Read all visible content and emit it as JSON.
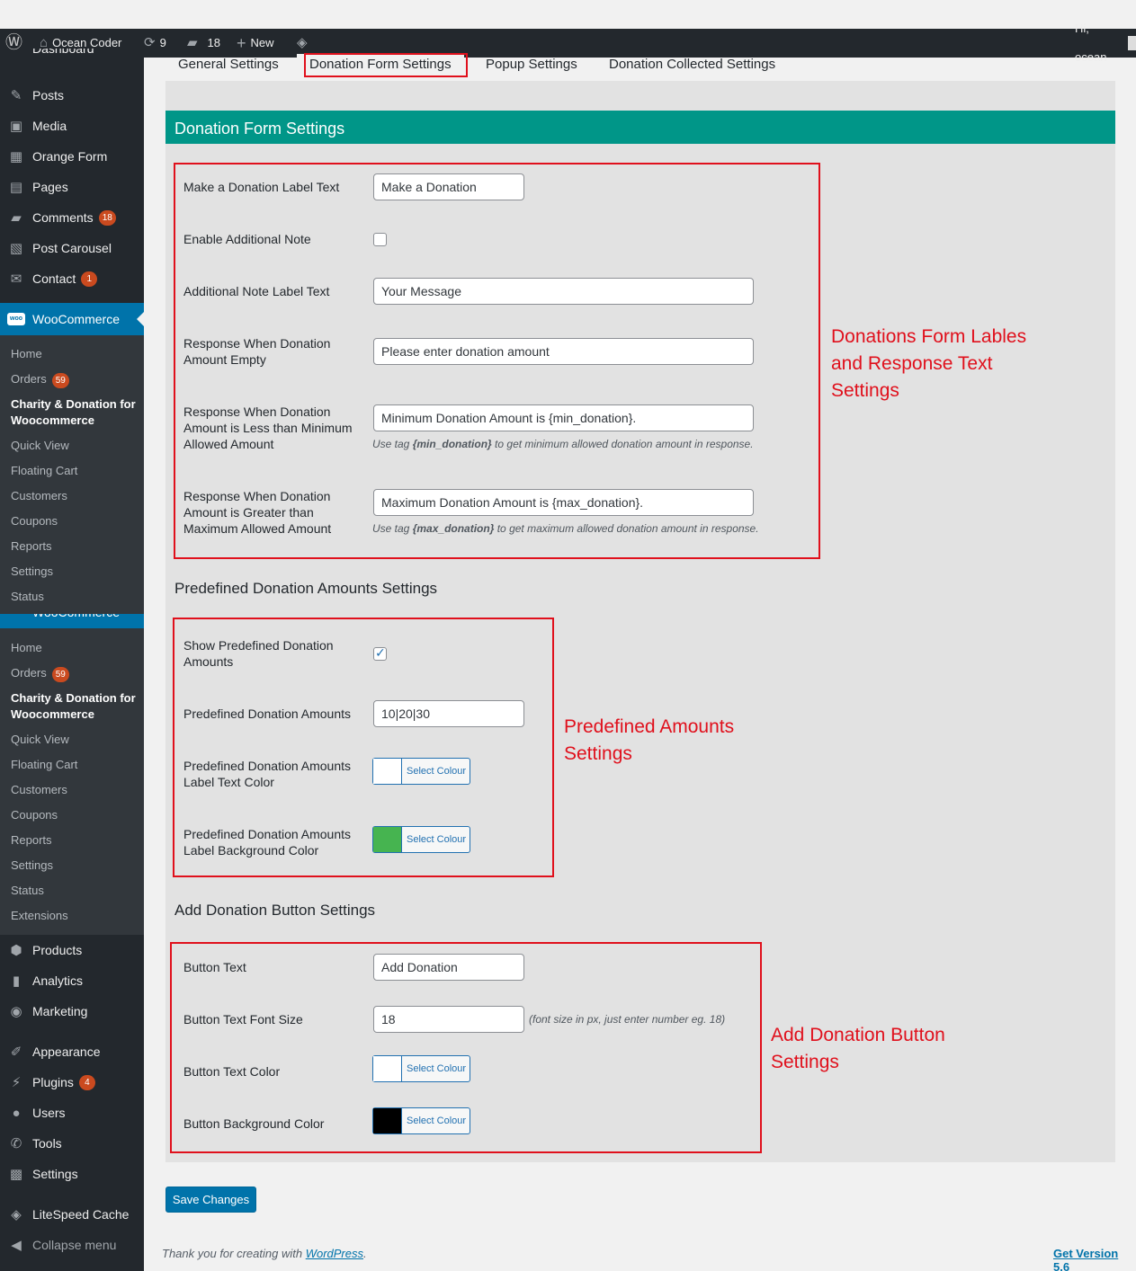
{
  "admin_bar": {
    "site_name": "Ocean Coder",
    "updates_count": "9",
    "comments_count": "18",
    "new_label": "New",
    "greeting": "Hi, ocean"
  },
  "sidebar": {
    "cutoff_top": "Dashboard",
    "items": [
      {
        "label": "Posts",
        "icon": "pin-icon"
      },
      {
        "label": "Media",
        "icon": "media-icon"
      },
      {
        "label": "Orange Form",
        "icon": "form-icon"
      },
      {
        "label": "Pages",
        "icon": "pages-icon"
      },
      {
        "label": "Comments",
        "icon": "comment-icon",
        "badge": "18"
      },
      {
        "label": "Post Carousel",
        "icon": "carousel-icon"
      },
      {
        "label": "Contact",
        "icon": "mail-icon",
        "badge": "1"
      }
    ],
    "woo": {
      "label": "WooCommerce",
      "logo": "woo",
      "submenu1": [
        "Home",
        "Orders",
        "Charity & Donation for Woocommerce",
        "Quick View",
        "Floating Cart",
        "Customers",
        "Coupons",
        "Reports",
        "Settings",
        "Status"
      ],
      "orders_badge": "59",
      "submenu2": [
        "Home",
        "Orders",
        "Charity & Donation for Woocommerce",
        "Quick View",
        "Floating Cart",
        "Customers",
        "Coupons",
        "Reports",
        "Settings",
        "Status",
        "Extensions"
      ]
    },
    "items2": [
      {
        "label": "Products",
        "icon": "box-icon"
      },
      {
        "label": "Analytics",
        "icon": "chart-icon"
      },
      {
        "label": "Marketing",
        "icon": "megaphone-icon"
      },
      {
        "label": "Appearance",
        "icon": "brush-icon"
      },
      {
        "label": "Plugins",
        "icon": "plug-icon",
        "badge": "4"
      },
      {
        "label": "Users",
        "icon": "user-icon"
      },
      {
        "label": "Tools",
        "icon": "wrench-icon"
      },
      {
        "label": "Settings",
        "icon": "sliders-icon"
      },
      {
        "label": "LiteSpeed Cache",
        "icon": "diamond-icon"
      },
      {
        "label": "Collapse menu",
        "icon": "collapse-icon"
      }
    ]
  },
  "tabs": [
    "General Settings",
    "Donation Form Settings",
    "Popup Settings",
    "Donation Collected Settings"
  ],
  "panel_title": "Donation Form Settings",
  "form": {
    "make_label": "Make a Donation Label Text",
    "make_value": "Make a Donation",
    "enable_note_label": "Enable Additional Note",
    "note_label_label": "Additional Note Label Text",
    "note_label_value": "Your Message",
    "empty_label": "Response When Donation Amount Empty",
    "empty_value": "Please enter donation amount",
    "less_label": "Response When Donation Amount is Less than Minimum Allowed Amount",
    "less_value": "Minimum Donation Amount is {min_donation}.",
    "less_desc_pre": "Use tag ",
    "less_desc_tag": "{min_donation}",
    "less_desc_post": " to get minimum allowed donation amount in response.",
    "greater_label": "Response When Donation Amount is Greater than Maximum Allowed Amount",
    "greater_value": "Maximum Donation Amount is {max_donation}.",
    "greater_desc_pre": "Use tag ",
    "greater_desc_tag": "{max_donation}",
    "greater_desc_post": " to get maximum allowed donation amount in response."
  },
  "predefined": {
    "title": "Predefined Donation Amounts Settings",
    "show_label": "Show Predefined Donation Amounts",
    "amounts_label": "Predefined Donation Amounts",
    "amounts_value": "10|20|30",
    "text_color_label": "Predefined Donation Amounts Label Text Color",
    "bg_color_label": "Predefined Donation Amounts Label Background Color",
    "text_color": "#ffffff",
    "bg_color": "#46b450"
  },
  "button": {
    "title": "Add Donation Button Settings",
    "text_label": "Button Text",
    "text_value": "Add Donation",
    "size_label": "Button Text Font Size",
    "size_value": "18",
    "size_desc": "(font size in px, just enter number eg. 18)",
    "color_label": "Button Text Color",
    "bg_label": "Button Background Color",
    "text_color": "#ffffff",
    "bg_color": "#000000"
  },
  "select_colour": "Select Colour",
  "annotations": {
    "form": "Donations Form Lables and Response Text Settings",
    "predefined": "Predefined Amounts Settings",
    "button": "Add Donation Button Settings"
  },
  "save_label": "Save Changes",
  "footer": {
    "thanks_pre": "Thank you for creating with ",
    "thanks_link": "WordPress",
    "thanks_post": ".",
    "version": "Get Version 5.6"
  },
  "colors": {
    "accent": "#009688",
    "annotation": "#e0101c",
    "wp_blue": "#0073aa"
  }
}
